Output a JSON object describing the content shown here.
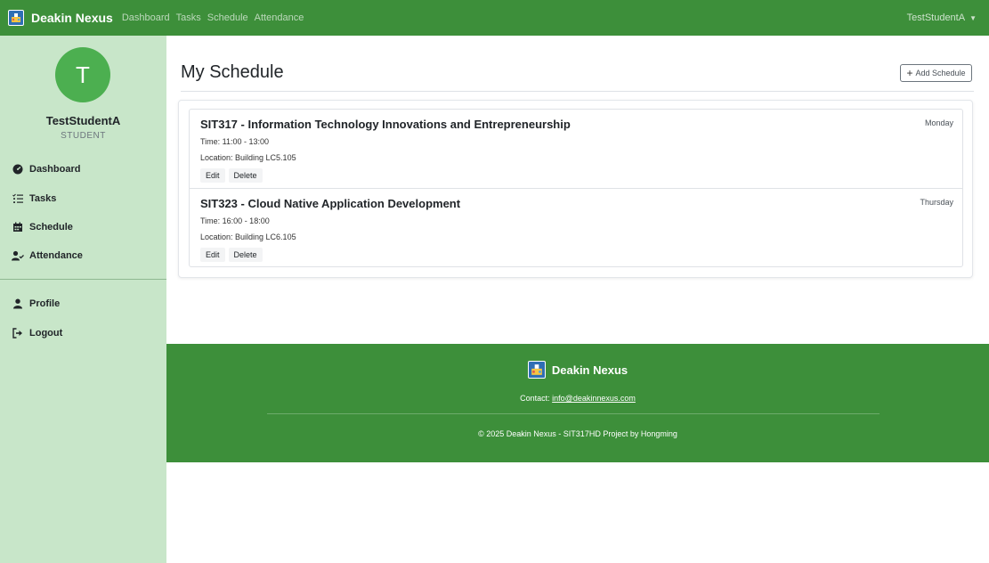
{
  "navbar": {
    "brand": "Deakin Nexus",
    "links": [
      "Dashboard",
      "Tasks",
      "Schedule",
      "Attendance"
    ],
    "user": "TestStudentA"
  },
  "sidebar": {
    "avatar_initial": "T",
    "name": "TestStudentA",
    "role": "STUDENT",
    "items": [
      {
        "label": "Dashboard",
        "icon": "tachometer-icon"
      },
      {
        "label": "Tasks",
        "icon": "task-list-icon"
      },
      {
        "label": "Schedule",
        "icon": "calendar-icon"
      },
      {
        "label": "Attendance",
        "icon": "user-check-icon"
      }
    ],
    "bottom_items": [
      {
        "label": "Profile",
        "icon": "user-icon"
      },
      {
        "label": "Logout",
        "icon": "sign-out-icon"
      }
    ]
  },
  "main": {
    "title": "My Schedule",
    "add_button": "Add Schedule",
    "schedules": [
      {
        "title": "SIT317 - Information Technology Innovations and Entrepreneurship",
        "day": "Monday",
        "time": "Time: 11:00 - 13:00",
        "location": "Location: Building LC5.105",
        "edit": "Edit",
        "delete": "Delete"
      },
      {
        "title": "SIT323 - Cloud Native Application Development",
        "day": "Thursday",
        "time": "Time: 16:00 - 18:00",
        "location": "Location: Building LC6.105",
        "edit": "Edit",
        "delete": "Delete"
      }
    ]
  },
  "footer": {
    "brand": "Deakin Nexus",
    "contact_label": "Contact:",
    "contact_email": "info@deakinnexus.com",
    "copyright": "© 2025 Deakin Nexus - SIT317HD Project by Hongming"
  },
  "colors": {
    "primary_green": "#3d8f3a",
    "sidebar_green": "#c8e6c9",
    "avatar_green": "#4caf50"
  }
}
